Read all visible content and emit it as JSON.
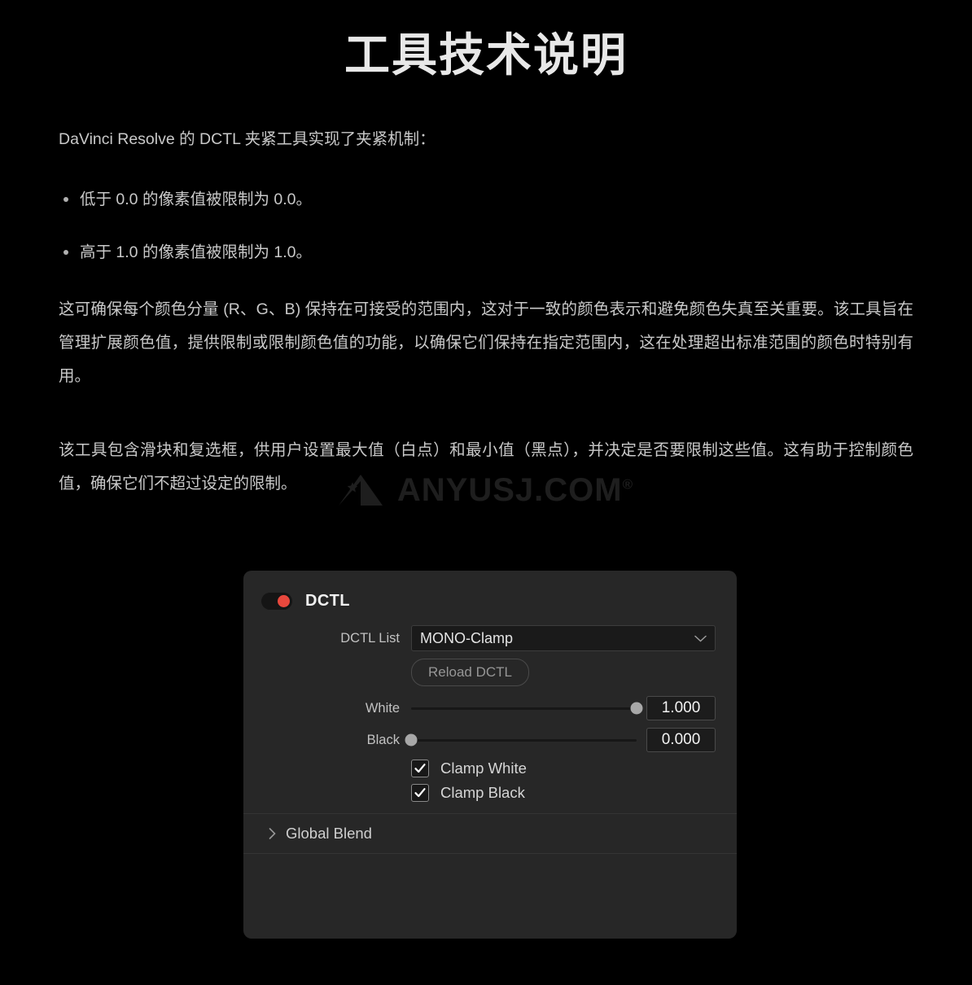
{
  "article": {
    "title": "工具技术说明",
    "intro": "DaVinci Resolve 的 DCTL 夹紧工具实现了夹紧机制：",
    "bullets": [
      "低于 0.0 的像素值被限制为 0.0。",
      "高于 1.0 的像素值被限制为 1.0。"
    ],
    "paragraph1": "这可确保每个颜色分量 (R、G、B) 保持在可接受的范围内，这对于一致的颜色表示和避免颜色失真至关重要。该工具旨在管理扩展颜色值，提供限制或限制颜色值的功能，以确保它们保持在指定范围内，这在处理超出标准范围的颜色时特别有用。",
    "paragraph2": "该工具包含滑块和复选框，供用户设置最大值（白点）和最小值（黑点），并决定是否要限制这些值。这有助于控制颜色值，确保它们不超过设定的限制。"
  },
  "watermark": {
    "text": "ANYUSJ.COM",
    "registered_mark": "®",
    "logo_icon": "triangle-star-logo-icon",
    "color": "#1e1e1e"
  },
  "panel": {
    "title": "DCTL",
    "enabled": true,
    "toggle_color": "#e8483d",
    "background": "#272727",
    "dctl_list": {
      "label": "DCTL List",
      "value": "MONO-Clamp",
      "icon": "chevron-down-icon"
    },
    "reload_button": {
      "label": "Reload DCTL"
    },
    "sliders": [
      {
        "label": "White",
        "value": "1.000",
        "percent": 100
      },
      {
        "label": "Black",
        "value": "0.000",
        "percent": 0
      }
    ],
    "checkboxes": [
      {
        "label": "Clamp White",
        "checked": true
      },
      {
        "label": "Clamp Black",
        "checked": true
      }
    ],
    "section": {
      "label": "Global Blend",
      "expanded": false,
      "icon": "chevron-right-icon"
    }
  }
}
